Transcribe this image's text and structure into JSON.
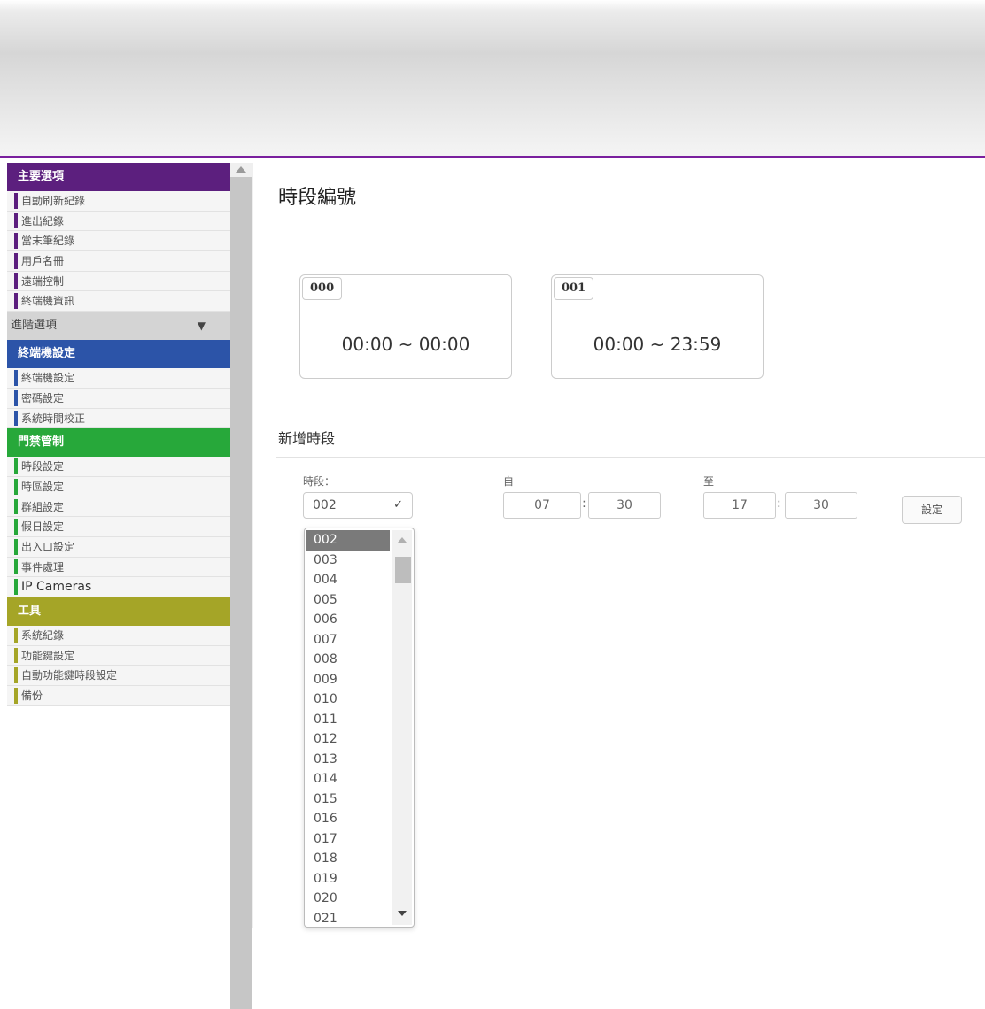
{
  "sidebar": {
    "main": {
      "title": "主要選項",
      "items": [
        "自動刷新紀錄",
        "進出紀錄",
        "當末筆紀錄",
        "用戶名冊",
        "遠端控制",
        "終端機資訊"
      ]
    },
    "advanced": {
      "title": "進階選項",
      "toggle_icon": "▼"
    },
    "controller": {
      "title": "終端機設定",
      "items": [
        "終端機設定",
        "密碼設定",
        "系統時間校正"
      ]
    },
    "access": {
      "title": "門禁管制",
      "items": [
        "時段設定",
        "時區設定",
        "群組設定",
        "假日設定",
        "出入口設定",
        "事件處理",
        "IP Cameras"
      ]
    },
    "tools": {
      "title": "工具",
      "items": [
        "系統紀錄",
        "功能鍵設定",
        "自動功能鍵時段設定",
        "備份"
      ]
    }
  },
  "main": {
    "title": "時段編號",
    "periods": [
      {
        "code": "000",
        "range": "00:00 ~ 00:00"
      },
      {
        "code": "001",
        "range": "00:00 ~ 23:59"
      }
    ],
    "new_section_title": "新增時段",
    "form": {
      "period_label": "時段：",
      "period_value": "002",
      "from_label": "自",
      "from_hour": "07",
      "from_min": "30",
      "to_label": "至",
      "to_hour": "17",
      "to_min": "30",
      "colon": ":",
      "set_button": "設定"
    },
    "dropdown_options": [
      "002",
      "003",
      "004",
      "005",
      "006",
      "007",
      "008",
      "009",
      "010",
      "011",
      "012",
      "013",
      "014",
      "015",
      "016",
      "017",
      "018",
      "019",
      "020",
      "021"
    ]
  },
  "colors": {
    "accent_purple": "#5c1f7e",
    "blue": "#2c54a8",
    "green": "#27a83a",
    "olive": "#a5a527"
  }
}
